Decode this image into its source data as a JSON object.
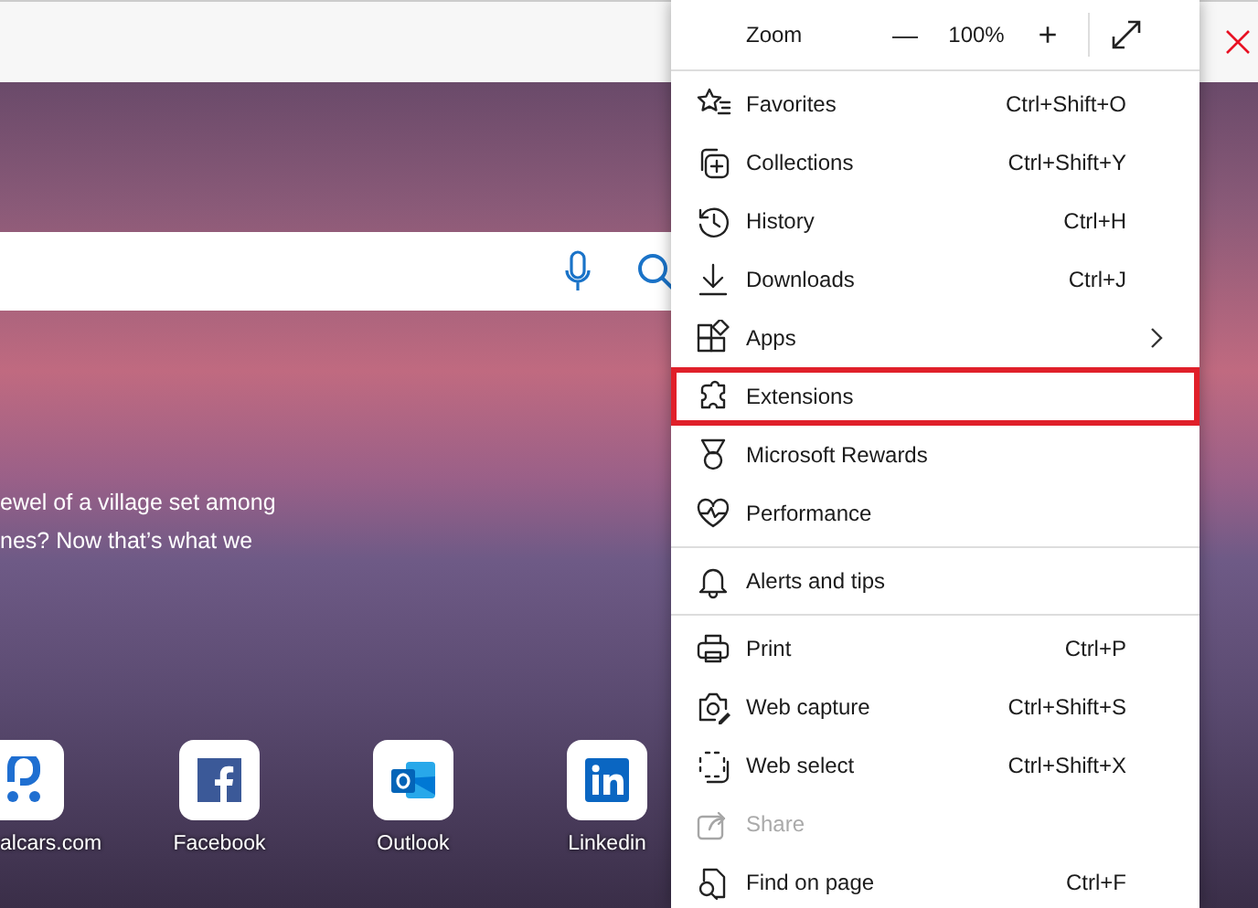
{
  "page": {
    "caption_lines": [
      "ewel of a village set among",
      "nes? Now that’s what we"
    ],
    "tiles": [
      {
        "label": "alcars.com"
      },
      {
        "label": "Facebook"
      },
      {
        "label": "Outlook"
      },
      {
        "label": "Linkedin"
      }
    ]
  },
  "menu": {
    "zoom": {
      "label": "Zoom",
      "minus": "—",
      "value": "100%",
      "plus": "+"
    },
    "sections": [
      {
        "items": [
          {
            "label": "Favorites",
            "shortcut": "Ctrl+Shift+O",
            "submenu": false,
            "disabled": false,
            "highlighted": false
          },
          {
            "label": "Collections",
            "shortcut": "Ctrl+Shift+Y",
            "submenu": false,
            "disabled": false,
            "highlighted": false
          },
          {
            "label": "History",
            "shortcut": "Ctrl+H",
            "submenu": false,
            "disabled": false,
            "highlighted": false
          },
          {
            "label": "Downloads",
            "shortcut": "Ctrl+J",
            "submenu": false,
            "disabled": false,
            "highlighted": false
          },
          {
            "label": "Apps",
            "submenu": true,
            "disabled": false,
            "highlighted": false
          },
          {
            "label": "Extensions",
            "submenu": false,
            "disabled": false,
            "highlighted": true
          },
          {
            "label": "Microsoft Rewards",
            "submenu": false,
            "disabled": false,
            "highlighted": false
          },
          {
            "label": "Performance",
            "submenu": false,
            "disabled": false,
            "highlighted": false
          }
        ]
      },
      {
        "items": [
          {
            "label": "Alerts and tips",
            "submenu": false,
            "disabled": false,
            "highlighted": false
          }
        ]
      },
      {
        "items": [
          {
            "label": "Print",
            "shortcut": "Ctrl+P",
            "submenu": false,
            "disabled": false,
            "highlighted": false
          },
          {
            "label": "Web capture",
            "shortcut": "Ctrl+Shift+S",
            "submenu": false,
            "disabled": false,
            "highlighted": false
          },
          {
            "label": "Web select",
            "shortcut": "Ctrl+Shift+X",
            "submenu": false,
            "disabled": false,
            "highlighted": false
          },
          {
            "label": "Share",
            "submenu": false,
            "disabled": true,
            "highlighted": false
          },
          {
            "label": "Find on page",
            "shortcut": "Ctrl+F",
            "submenu": false,
            "disabled": false,
            "highlighted": false
          }
        ]
      }
    ]
  }
}
